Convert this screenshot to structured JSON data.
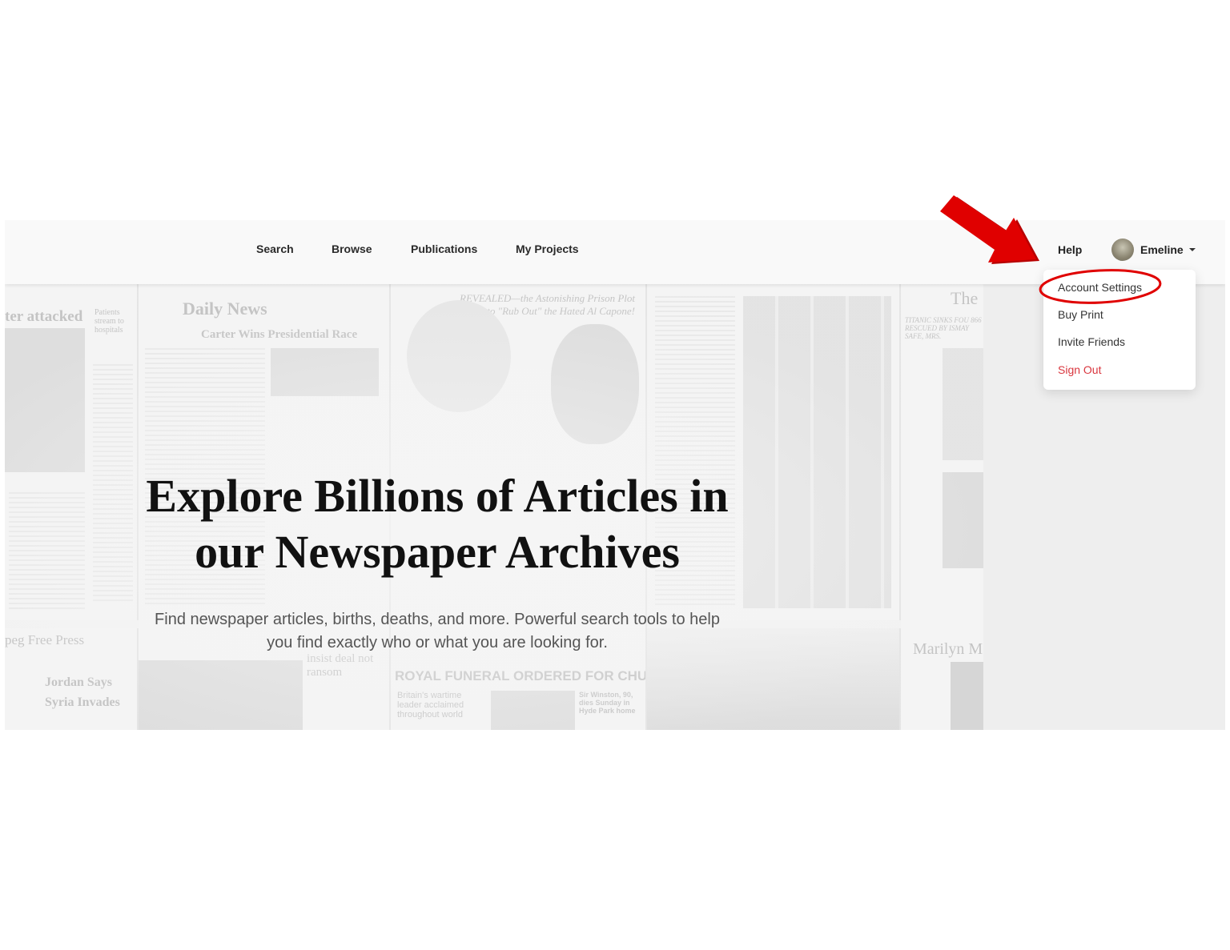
{
  "nav": {
    "links": [
      "Search",
      "Browse",
      "Publications",
      "My Projects"
    ],
    "help": "Help",
    "user_name": "Emeline"
  },
  "user_menu": {
    "items": [
      {
        "label": "Account Settings",
        "color": "#333333"
      },
      {
        "label": "Buy Print",
        "color": "#333333"
      },
      {
        "label": "Invite Friends",
        "color": "#333333"
      },
      {
        "label": "Sign Out",
        "color": "#d9363e"
      }
    ]
  },
  "hero": {
    "title_line1": "Explore Billions of Articles in",
    "title_line2": "our Newspaper Archives",
    "subtitle_line1": "Find newspaper articles, births, deaths, and more. Powerful search tools to help",
    "subtitle_line2": "you find exactly who or what you are looking for."
  },
  "background_headlines": {
    "p1": "ter attacked",
    "p1b": "Patients stream to hospitals",
    "p2_masthead": "Daily News",
    "p2": "Carter Wins Presidential Race",
    "p3": "REVEALED—the Astonishing Prison Plot to \"Rub Out\" the Hated Al Capone!",
    "p5": "The",
    "p5b": "TITANIC SINKS FOU 866 RESCUED BY ISMAY SAFE, MRS.",
    "p6": "peg Free Press",
    "p6b": "Jordan Says Syria Invades",
    "p7": "insist deal not ransom",
    "p8": "ROYAL FUNERAL ORDERED FOR CHURCHILL",
    "p8b": "Britain's wartime leader acclaimed throughout world",
    "p8c": "Sir Winston, 90, dies Sunday in Hyde Park home",
    "p9": "Marilyn M"
  },
  "annotations": {
    "arrow_color": "#e00000",
    "circle_color": "#e00000"
  }
}
